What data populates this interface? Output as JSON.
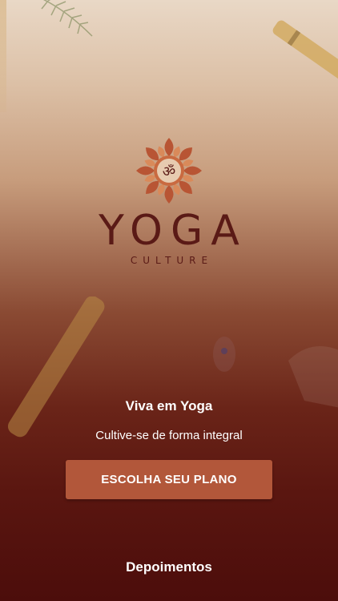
{
  "logo": {
    "symbol": "ॐ",
    "word": "YOGA",
    "sub": "CULTURE"
  },
  "hero": {
    "headline": "Viva em Yoga",
    "subline": "Cultive-se de forma integral"
  },
  "cta": {
    "label": "ESCOLHA SEU PLANO"
  },
  "footer": {
    "testimonials_label": "Depoimentos"
  },
  "colors": {
    "brand_dark": "#5a1a16",
    "button": "#b2573a",
    "text_light": "#ffffff"
  }
}
